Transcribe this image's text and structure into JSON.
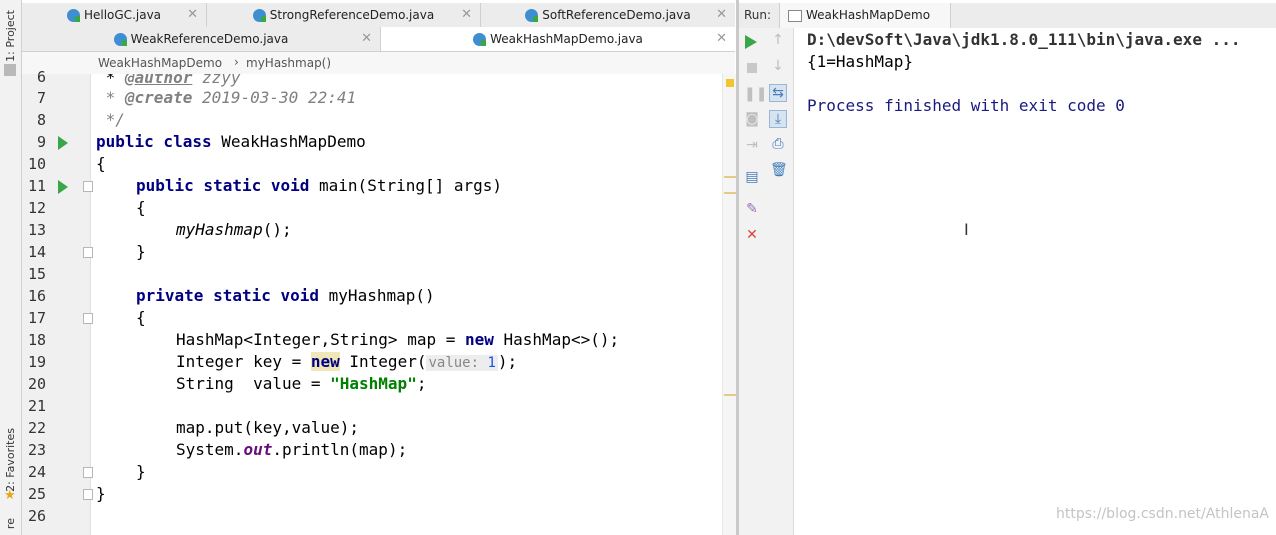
{
  "left_strip": {
    "project_label": "1: Project",
    "favorites_label": "2: Favorites",
    "structure_label": "re"
  },
  "tabs": {
    "row1": [
      "HelloGC.java",
      "StrongReferenceDemo.java",
      "SoftReferenceDemo.java"
    ],
    "row2": [
      "WeakReferenceDemo.java",
      "WeakHashMapDemo.java"
    ],
    "active": "WeakHashMapDemo.java"
  },
  "breadcrumb": {
    "class_name": "WeakHashMapDemo",
    "separator": "›",
    "method_name": "myHashmap()"
  },
  "editor": {
    "line_numbers": [
      "6",
      "7",
      "8",
      "9",
      "10",
      "11",
      "12",
      "13",
      "14",
      "15",
      "16",
      "17",
      "18",
      "19",
      "20",
      "21",
      "22",
      "23",
      "24",
      "25",
      "26"
    ],
    "line6": {
      "tag": "@author",
      "rest": " zzyy"
    },
    "line7": {
      "star": " * ",
      "tag": "@create",
      "rest": " 2019-03-30 22:41"
    },
    "line8": " */",
    "line9": {
      "kw": "public class",
      "rest": " WeakHashMapDemo"
    },
    "line10": "{",
    "line11": {
      "kw": "public static void",
      "rest": " main(String[] args)"
    },
    "line12": "{",
    "line13": {
      "call": "myHashmap",
      "rest": "();"
    },
    "line14": "}",
    "line16": {
      "kw": "private static void",
      "rest": " myHashmap()"
    },
    "line17": "{",
    "line18": {
      "a": "HashMap<Integer,String> map = ",
      "kw": "new",
      "b": " HashMap<>();"
    },
    "line19": {
      "a": "Integer key = ",
      "kw": "new",
      "b": " Integer(",
      "hint": "value: ",
      "num": "1",
      "c": ");"
    },
    "line20": {
      "a": "String  value = ",
      "str": "\"HashMap\"",
      "c": ";"
    },
    "line22": "map.put(key,value);",
    "line23": {
      "a": "System.",
      "fld": "out",
      "b": ".println(map);"
    },
    "line24": "}",
    "line25": "}"
  },
  "run": {
    "label": "Run:",
    "tab": "WeakHashMapDemo",
    "console": [
      "D:\\devSoft\\Java\\jdk1.8.0_111\\bin\\java.exe ...",
      "{1=HashMap}",
      "",
      "Process finished with exit code 0"
    ]
  },
  "watermark": "https://blog.csdn.net/AthlenaA",
  "icons": [
    "run-icon",
    "stop-icon",
    "pause-icon",
    "camera-icon",
    "login-icon",
    "layout-icon",
    "pin-icon",
    "close-icon",
    "up-arrow-icon",
    "down-arrow-icon",
    "wrap-icon",
    "scroll-icon",
    "print-icon",
    "trash-icon"
  ],
  "colors": {
    "keyword": "#000080",
    "string": "#008000",
    "run_green": "#3aa64a",
    "stop_red": "#d9453b",
    "caret_line": "#fdf6dc"
  }
}
